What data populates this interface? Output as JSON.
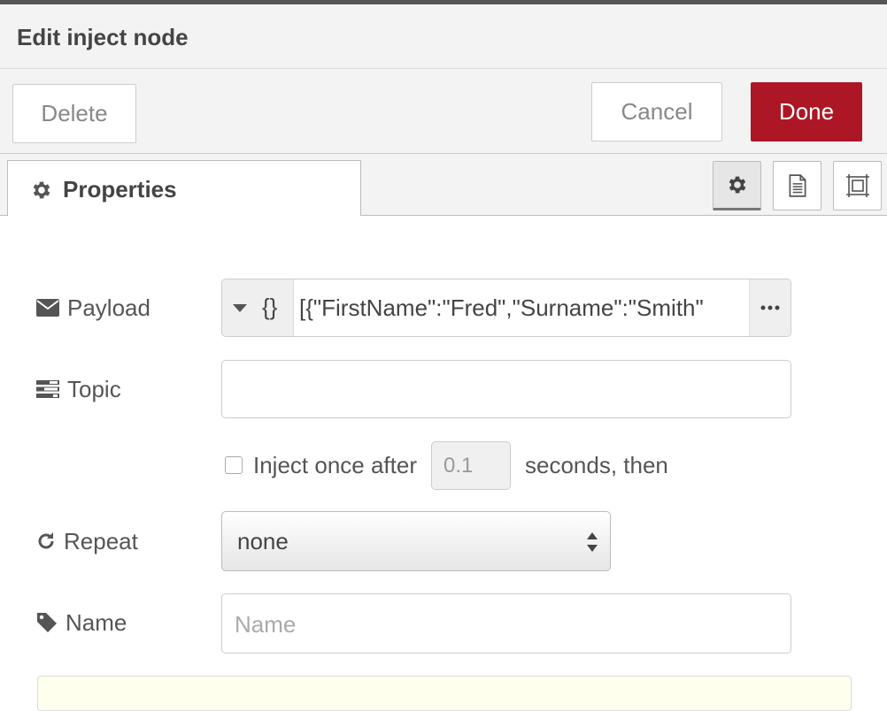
{
  "dialog": {
    "title": "Edit inject node"
  },
  "toolbar": {
    "delete_label": "Delete",
    "cancel_label": "Cancel",
    "done_label": "Done"
  },
  "tabs": {
    "properties_label": "Properties"
  },
  "form": {
    "payload": {
      "label": "Payload",
      "type_glyph": "{}",
      "value": "[{\"FirstName\":\"Fred\",\"Surname\":\"Smith\""
    },
    "topic": {
      "label": "Topic",
      "value": ""
    },
    "inject": {
      "label": "Inject once after",
      "delay": "0.1",
      "suffix": "seconds, then",
      "checked": false
    },
    "repeat": {
      "label": "Repeat",
      "value": "none"
    },
    "name": {
      "label": "Name",
      "placeholder": "Name",
      "value": ""
    }
  },
  "colors": {
    "done_button": "#ad1625",
    "tip_background": "#ffffee"
  }
}
